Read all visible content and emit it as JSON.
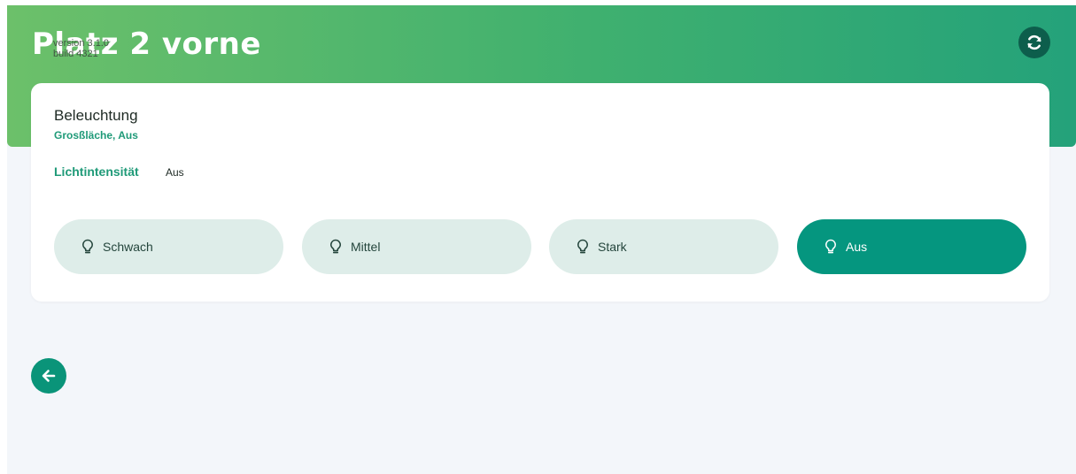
{
  "header": {
    "title": "Platz 2 vorne",
    "version": "version 3.1.0",
    "build": "build 4321",
    "refresh_icon": "refresh-icon"
  },
  "card": {
    "title": "Beleuchtung",
    "subtitle": "Grosßläche, Aus",
    "intensity_label": "Lichtintensität",
    "intensity_value": "Aus",
    "options": [
      {
        "label": "Schwach",
        "icon": "lightbulb-icon",
        "active": false
      },
      {
        "label": "Mittel",
        "icon": "lightbulb-icon",
        "active": false
      },
      {
        "label": "Stark",
        "icon": "lightbulb-icon",
        "active": false
      },
      {
        "label": "Aus",
        "icon": "lightbulb-icon",
        "active": true
      }
    ]
  },
  "navigation": {
    "back_icon": "arrow-left-icon"
  },
  "colors": {
    "accent": "#05967f",
    "accent_dark": "#0d5e4c",
    "option_inactive": "#deede9",
    "header_gradient_start": "#6cc06a",
    "header_gradient_end": "#24a27a",
    "page_background": "#f3f6fa"
  }
}
